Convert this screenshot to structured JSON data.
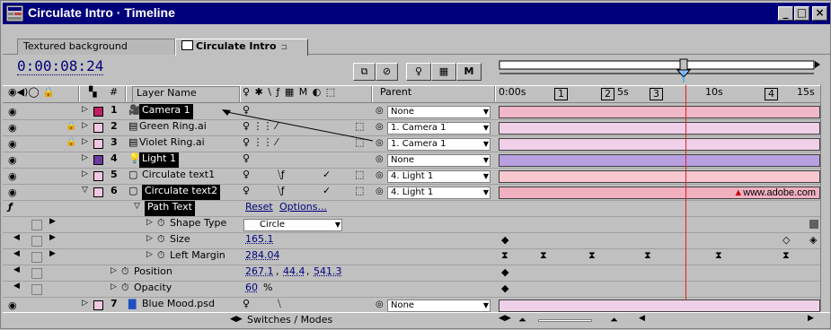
{
  "window": {
    "title": "Circulate Intro · Timeline",
    "minimize": "_",
    "maximize": "□",
    "close": "×"
  },
  "tabs": [
    {
      "label": "Textured background"
    },
    {
      "label": "Circulate Intro"
    }
  ],
  "timecode": "0:00:08:24",
  "ruler": {
    "labels": [
      "0:00s",
      "5s",
      "10s",
      "15s"
    ],
    "markers": [
      "1",
      "2",
      "3",
      "4"
    ]
  },
  "header": {
    "layer_name": "Layer Name",
    "num": "#",
    "parent": "Parent",
    "switches": "♀ ✱ \\ ƒ ▦ M ◐ ⬚"
  },
  "layers": [
    {
      "num": "1",
      "name": "Camera 1",
      "label_color": "#c02060",
      "parent": "None",
      "bar_color": "#f0b8c8"
    },
    {
      "num": "2",
      "name": "Green Ring.ai",
      "label_color": "#f0c8e0",
      "parent": "1. Camera 1",
      "bar_color": "#f0d0e8"
    },
    {
      "num": "3",
      "name": "Violet Ring.ai",
      "label_color": "#f0c8e0",
      "parent": "1. Camera 1",
      "bar_color": "#f0d0e8"
    },
    {
      "num": "4",
      "name": "Light 1",
      "label_color": "#6a3ca0",
      "parent": "None",
      "bar_color": "#b8a0e0"
    },
    {
      "num": "5",
      "name": "Circulate text1",
      "label_color": "#f0c8e0",
      "parent": "4. Light 1",
      "bar_color": "#f8c8d0"
    },
    {
      "num": "6",
      "name": "Circulate text2",
      "label_color": "#f0c8e0",
      "parent": "4. Light 1",
      "bar_color": "#f0b0c0"
    },
    {
      "num": "7",
      "name": "Blue Mood.psd",
      "label_color": "#f0c8e0",
      "parent": "None",
      "bar_color": "#f0d0e8"
    }
  ],
  "path_text": {
    "label": "Path Text",
    "reset": "Reset",
    "options": "Options...",
    "shape_type_label": "Shape Type",
    "shape_type_value": "Circle",
    "size_label": "Size",
    "size_value": "165.1",
    "left_margin_label": "Left Margin",
    "left_margin_value": "284.04"
  },
  "position": {
    "label": "Position",
    "x": "267.1",
    "y": "44.4",
    "z": "541.3"
  },
  "opacity": {
    "label": "Opacity",
    "value": "60",
    "unit": "%"
  },
  "footer": {
    "label": "Switches / Modes"
  },
  "watermark": "www.adobe.com",
  "colors": {
    "title_bg": "#00007b",
    "cti": "#e02020",
    "timecode": "#00007b"
  }
}
